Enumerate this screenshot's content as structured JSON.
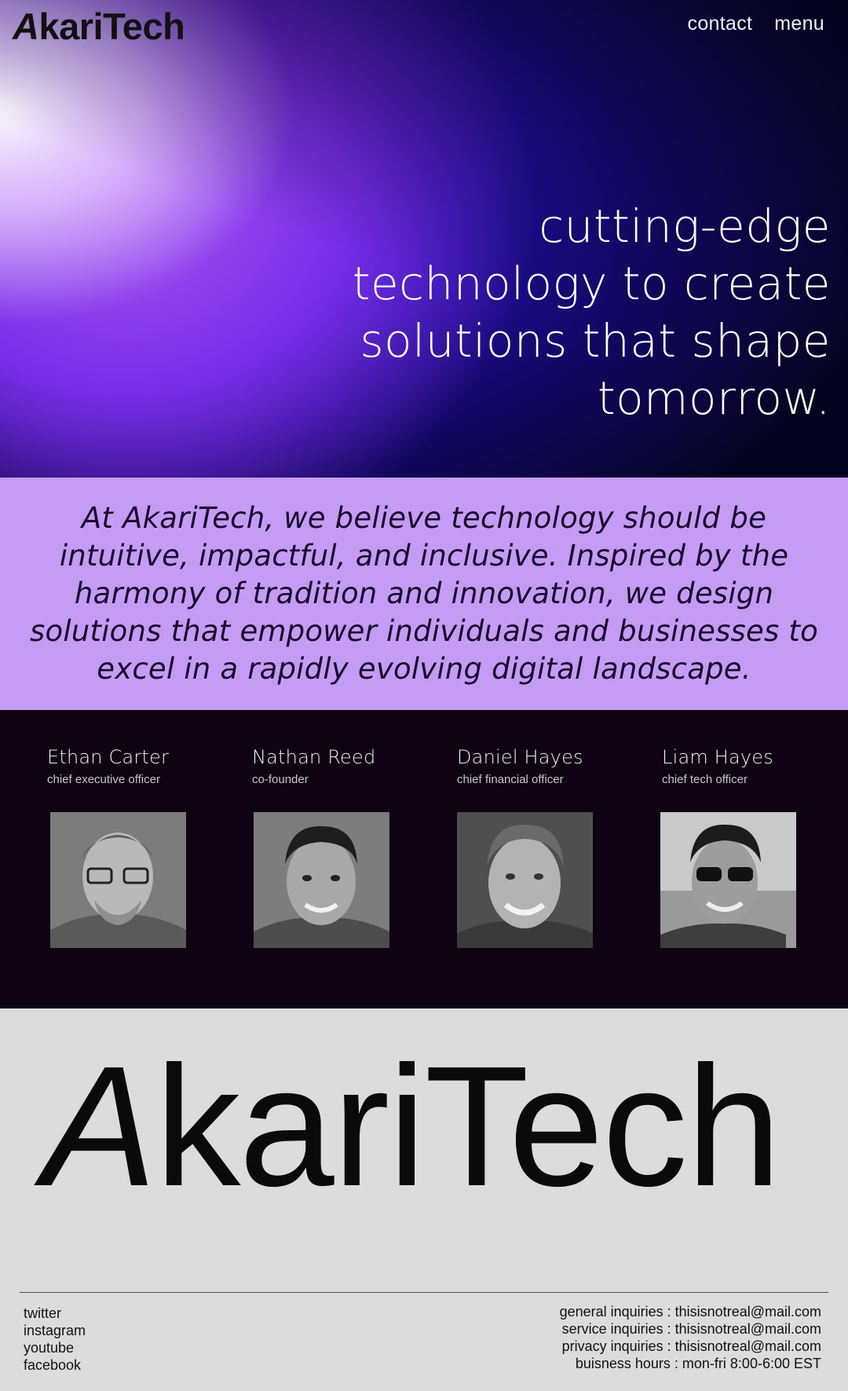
{
  "header": {
    "logo": "AkariTech",
    "nav": [
      {
        "label": "contact"
      },
      {
        "label": "menu"
      }
    ]
  },
  "hero": {
    "lines": [
      "cutting-edge",
      "technology to create",
      "solutions that shape",
      "tomorrow."
    ]
  },
  "mission": {
    "text": "At AkariTech, we believe technology should be intuitive, impactful, and inclusive. Inspired by the harmony of tradition and innovation, we design solutions that empower individuals and businesses to excel in a rapidly evolving digital landscape."
  },
  "team": [
    {
      "name": "Ethan Carter",
      "role": "chief executive officer"
    },
    {
      "name": "Nathan Reed",
      "role": "co-founder"
    },
    {
      "name": "Daniel Hayes",
      "role": "chief financial officer"
    },
    {
      "name": "Liam Hayes",
      "role": "chief tech officer"
    }
  ],
  "brand": {
    "wordmark": "AkariTech"
  },
  "footer": {
    "social": [
      "twitter",
      "instagram",
      "youtube",
      "facebook"
    ],
    "contact": [
      "general inquiries : thisisnotreal@mail.com",
      "service inquiries : thisisnotreal@mail.com",
      "privacy inquiries : thisisnotreal@mail.com",
      "buisness hours : mon-fri 8:00-6:00 EST"
    ]
  },
  "colors": {
    "mission_bg": "#c49cf5",
    "team_bg": "#0f0313",
    "footer_bg": "#dcdcdc"
  }
}
